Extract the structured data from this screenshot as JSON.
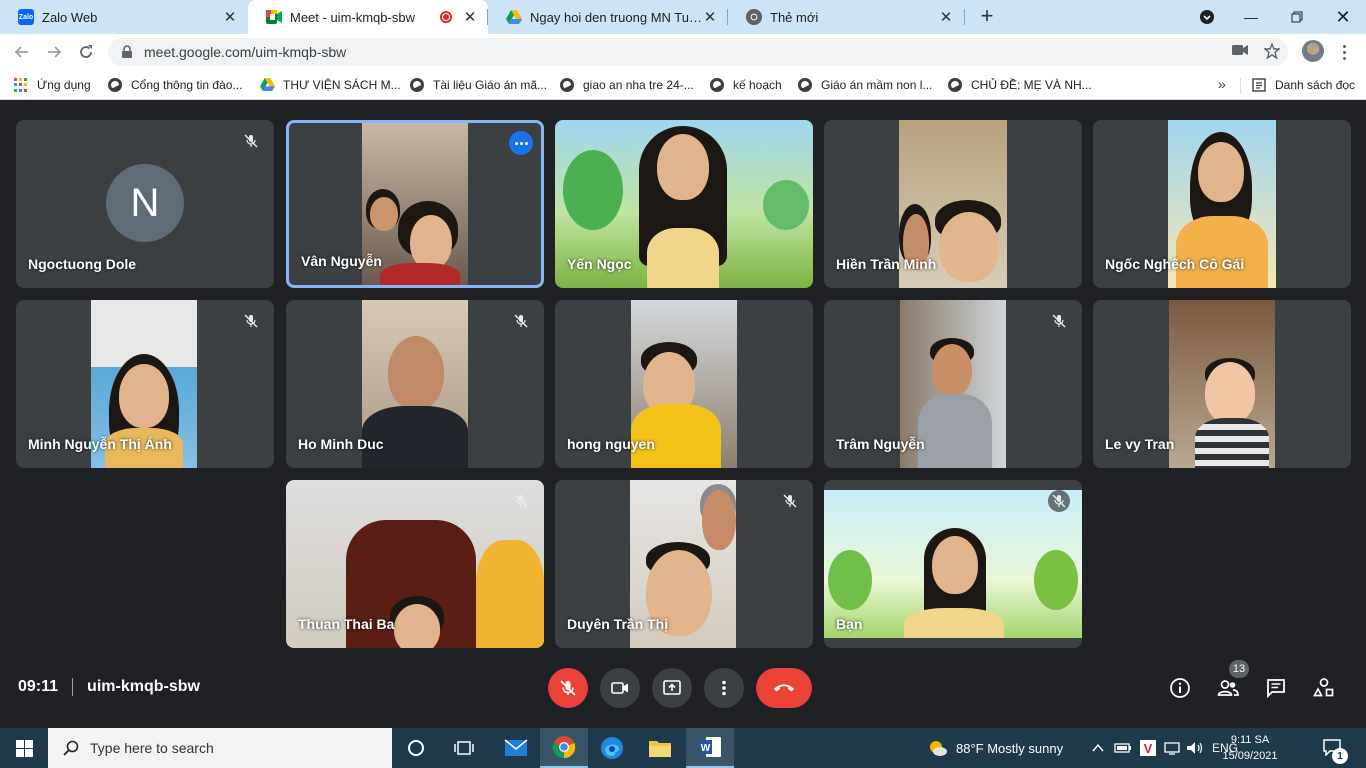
{
  "browser": {
    "tabs": [
      {
        "title": "Zalo Web",
        "favicon": "zalo-icon",
        "active": false
      },
      {
        "title": "Meet - uim-kmqb-sbw",
        "favicon": "google-meet-icon",
        "active": true,
        "recording": true
      },
      {
        "title": "Ngay hoi den truong MN Tuoi Xanh",
        "favicon": "google-drive-icon",
        "active": false
      },
      {
        "title": "Thẻ mới",
        "favicon": "chrome-icon",
        "active": false
      }
    ],
    "url": "meet.google.com/uim-kmqb-sbw",
    "bookmarks": [
      {
        "label": "Ứng dụng",
        "icon": "apps-grid-icon"
      },
      {
        "label": "Cổng thông tin đào...",
        "icon": "globe-icon"
      },
      {
        "label": "THƯ VIỆN SÁCH M...",
        "icon": "google-drive-icon"
      },
      {
        "label": "Tài liệu Giáo án mã...",
        "icon": "globe-icon"
      },
      {
        "label": "giao an nha tre 24-...",
        "icon": "globe-icon"
      },
      {
        "label": "kế hoạch",
        "icon": "globe-icon"
      },
      {
        "label": "Giáo án mầm non l...",
        "icon": "globe-icon"
      },
      {
        "label": "CHỦ ĐỀ: MẸ VÀ NH...",
        "icon": "globe-icon"
      }
    ],
    "bookmarks_more": "»",
    "reading_list": "Danh sách đọc"
  },
  "meet": {
    "meeting_time": "09:11",
    "meeting_code": "uim-kmqb-sbw",
    "participant_count": "13",
    "participants": [
      {
        "name": "Ngoctuong Dole",
        "initial": "N",
        "muted": true
      },
      {
        "name": "Vân Nguyễn",
        "muted": false,
        "speaking": true
      },
      {
        "name": "Yến Ngọc",
        "muted": false
      },
      {
        "name": "Hiền Trần Minh",
        "muted": false
      },
      {
        "name": "Ngốc Nghếch Cô Gái",
        "muted": false
      },
      {
        "name": "Minh Nguyễn Thị Ánh",
        "muted": true
      },
      {
        "name": "Ho Minh Duc",
        "muted": true
      },
      {
        "name": "hong nguyen",
        "muted": false
      },
      {
        "name": "Trâm Nguyễn",
        "muted": true
      },
      {
        "name": "Le vy Tran",
        "muted": false
      },
      {
        "name": "Thuan Thai Ba",
        "muted": true
      },
      {
        "name": "Duyên Trần Thị",
        "muted": true
      },
      {
        "name": "Bạn",
        "muted": true
      }
    ]
  },
  "taskbar": {
    "search_placeholder": "Type here to search",
    "weather": "88°F  Mostly sunny",
    "language": "ENG",
    "time": "9:11 SA",
    "date": "15/09/2021",
    "notification_count": "1"
  },
  "colors": {
    "meet_bg": "#202124",
    "tile_bg": "#3c4043",
    "end_call": "#ea4335",
    "speaking_border": "#8ab4f8",
    "tabstrip": "#cde4f7",
    "taskbar": "#1f3a4b"
  }
}
